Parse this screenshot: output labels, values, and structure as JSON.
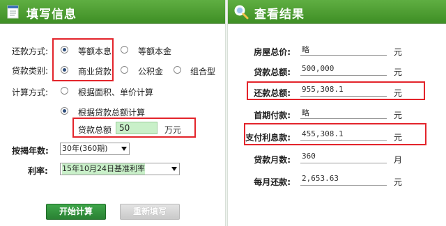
{
  "left_panel": {
    "title": "填写信息",
    "repayment_method": {
      "label": "还款方式:",
      "options": [
        "等额本息",
        "等额本金"
      ],
      "selected": "等额本息"
    },
    "loan_type": {
      "label": "贷款类别:",
      "options": [
        "商业贷款",
        "公积金",
        "组合型"
      ],
      "selected": "商业贷款"
    },
    "calc_method": {
      "label": "计算方式:",
      "options": [
        "根据面积、单价计算",
        "根据贷款总额计算"
      ],
      "selected": "根据贷款总额计算"
    },
    "loan_total": {
      "label": "贷款总额",
      "value": "50",
      "unit": "万元"
    },
    "mortgage_years": {
      "label": "按揭年数:",
      "value": "30年(360期)"
    },
    "interest_rate": {
      "label": "利率:",
      "value": "15年10月24日基准利率"
    },
    "buttons": {
      "calculate": "开始计算",
      "reset": "重新填写"
    }
  },
  "right_panel": {
    "title": "查看结果",
    "rows": [
      {
        "label": "房屋总价:",
        "value": "略",
        "unit": "元"
      },
      {
        "label": "贷款总额:",
        "value": "500,000",
        "unit": "元"
      },
      {
        "label": "还款总额:",
        "value": "955,308.1",
        "unit": "元"
      },
      {
        "label": "首期付款:",
        "value": "略",
        "unit": "元"
      },
      {
        "label": "支付利息款:",
        "value": "455,308.1",
        "unit": "元"
      },
      {
        "label": "贷款月数:",
        "value": "360",
        "unit": "月"
      },
      {
        "label": "每月还款:",
        "value": "2,653.63",
        "unit": "元"
      }
    ]
  },
  "colors": {
    "header_green": "#4a9d30",
    "highlight_red": "#e3242b",
    "input_green": "#c9f0c9"
  },
  "icons": {
    "left_header": "form-icon",
    "right_header": "magnifier-icon"
  }
}
